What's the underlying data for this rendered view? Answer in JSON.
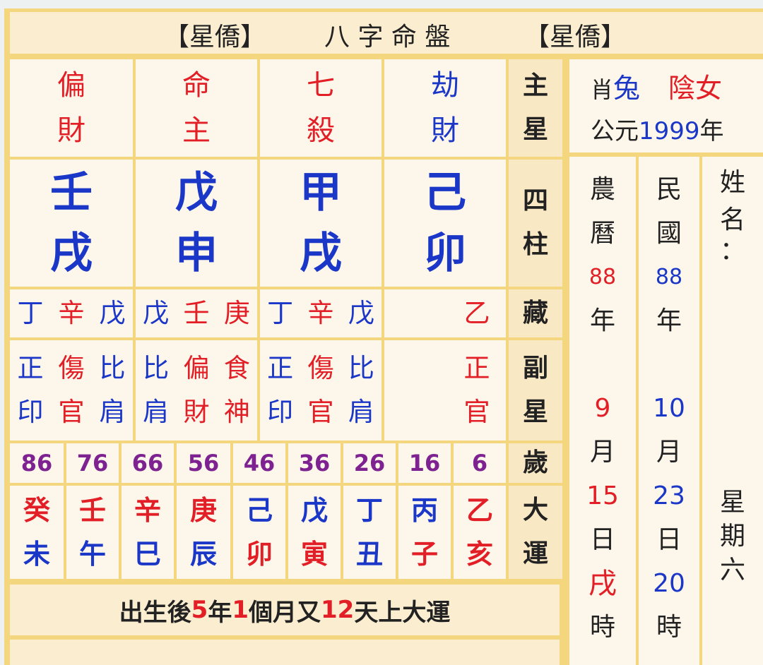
{
  "header": {
    "left_brand": "【星僑】",
    "title": "八 字 命 盤",
    "right_brand": "【星僑】"
  },
  "main_stars": [
    {
      "top": "偏",
      "bottom": "財",
      "color": "#e21f26"
    },
    {
      "top": "命",
      "bottom": "主",
      "color": "#e21f26"
    },
    {
      "top": "七",
      "bottom": "殺",
      "color": "#e21f26"
    },
    {
      "top": "劫",
      "bottom": "財",
      "color": "#1a37c8"
    }
  ],
  "pillars": [
    {
      "stem": "壬",
      "branch": "戌"
    },
    {
      "stem": "戊",
      "branch": "申"
    },
    {
      "stem": "甲",
      "branch": "戌"
    },
    {
      "stem": "己",
      "branch": "卯"
    }
  ],
  "hidden_stems": [
    [
      "丁",
      "辛",
      "戊"
    ],
    [
      "戊",
      "壬",
      "庚"
    ],
    [
      "丁",
      "辛",
      "戊"
    ],
    [
      "",
      "",
      "乙"
    ]
  ],
  "sub_stars": [
    [
      [
        "正",
        "印"
      ],
      [
        "傷",
        "官"
      ],
      [
        "比",
        "肩"
      ]
    ],
    [
      [
        "比",
        "肩"
      ],
      [
        "偏",
        "財"
      ],
      [
        "食",
        "神"
      ]
    ],
    [
      [
        "正",
        "印"
      ],
      [
        "傷",
        "官"
      ],
      [
        "比",
        "肩"
      ]
    ],
    [
      [
        "",
        ""
      ],
      [
        "",
        ""
      ],
      [
        "正",
        "官"
      ]
    ]
  ],
  "side_labels": {
    "main_star": [
      "主",
      "星"
    ],
    "four_pillars": [
      "四",
      "柱"
    ],
    "hidden": [
      "藏"
    ],
    "sub_star": [
      "副",
      "星"
    ],
    "age": [
      "歲"
    ],
    "luck": [
      "大",
      "運"
    ]
  },
  "ages": [
    "86",
    "76",
    "66",
    "56",
    "46",
    "36",
    "26",
    "16",
    "6"
  ],
  "luck_pillars": [
    {
      "stem": "癸",
      "branch": "未"
    },
    {
      "stem": "壬",
      "branch": "午"
    },
    {
      "stem": "辛",
      "branch": "巳"
    },
    {
      "stem": "庚",
      "branch": "辰"
    },
    {
      "stem": "己",
      "branch": "卯"
    },
    {
      "stem": "戊",
      "branch": "寅"
    },
    {
      "stem": "丁",
      "branch": "丑"
    },
    {
      "stem": "丙",
      "branch": "子"
    },
    {
      "stem": "乙",
      "branch": "亥"
    }
  ],
  "footer": {
    "p1": "出生後",
    "years": "5",
    "p2": "年",
    "months": "1",
    "p3": "個月又",
    "days": "12",
    "p4": "天上大運"
  },
  "profile": {
    "zodiac_prefix": "肖",
    "zodiac": "兔",
    "gender": "陰女",
    "year_prefix": "公元",
    "year": "1999",
    "year_suffix": "年"
  },
  "lunar": {
    "label1": "農",
    "label2": "曆",
    "year": "88",
    "year_unit": "年",
    "month": "9",
    "month_unit": "月",
    "day": "15",
    "day_unit": "日",
    "hour": "戌",
    "hour_unit": "時"
  },
  "minguo": {
    "label1": "民",
    "label2": "國",
    "year": "88",
    "year_unit": "年",
    "month": "10",
    "month_unit": "月",
    "day": "23",
    "day_unit": "日",
    "hour": "20",
    "hour_unit": "時"
  },
  "name_col": {
    "label1": "姓",
    "label2": "名",
    "colon": "：",
    "weekday1": "星",
    "weekday2": "期",
    "weekday3": "六"
  },
  "colors": {
    "red": "#e21f26",
    "blue": "#1a37c8",
    "purple": "#7d2290",
    "frame": "#f3d67e",
    "cell": "#fdf6ea"
  }
}
